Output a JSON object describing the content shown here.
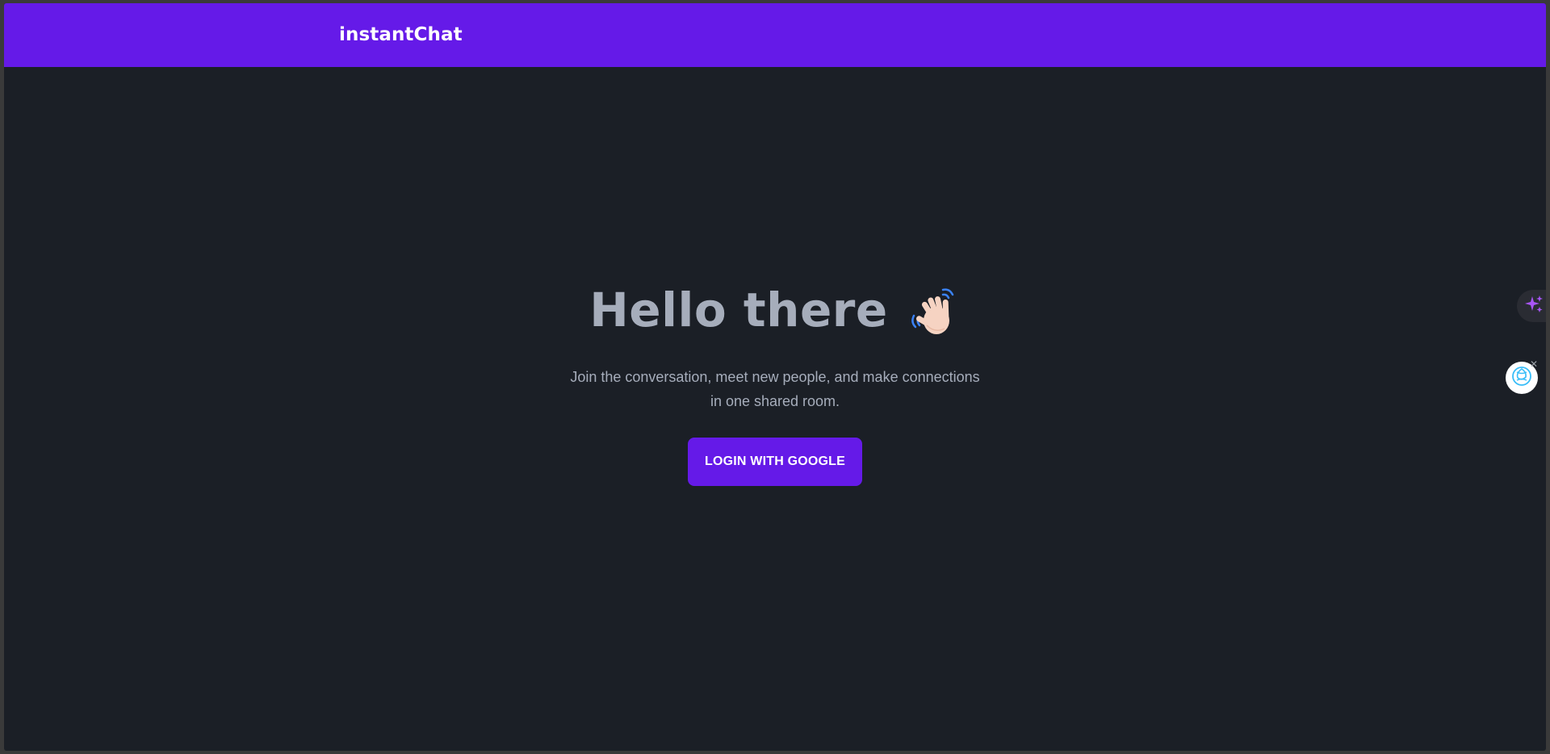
{
  "navbar": {
    "brand": "instantChat",
    "color": "#651ae8"
  },
  "hero": {
    "title": "Hello there",
    "wave_icon": "waving-hand-icon",
    "subtitle_line1": "Join the conversation, meet new people, and make connections",
    "subtitle_line2": "in one shared room.",
    "login_label": "LOGIN WITH GOOGLE"
  },
  "side_widgets": {
    "sparkle_icon": "sparkle-icon",
    "gpt_icon": "chatgpt-icon",
    "close_icon": "close-icon"
  },
  "colors": {
    "background": "#1b1f26",
    "accent": "#651ae8",
    "text_muted": "#a6adbb"
  }
}
